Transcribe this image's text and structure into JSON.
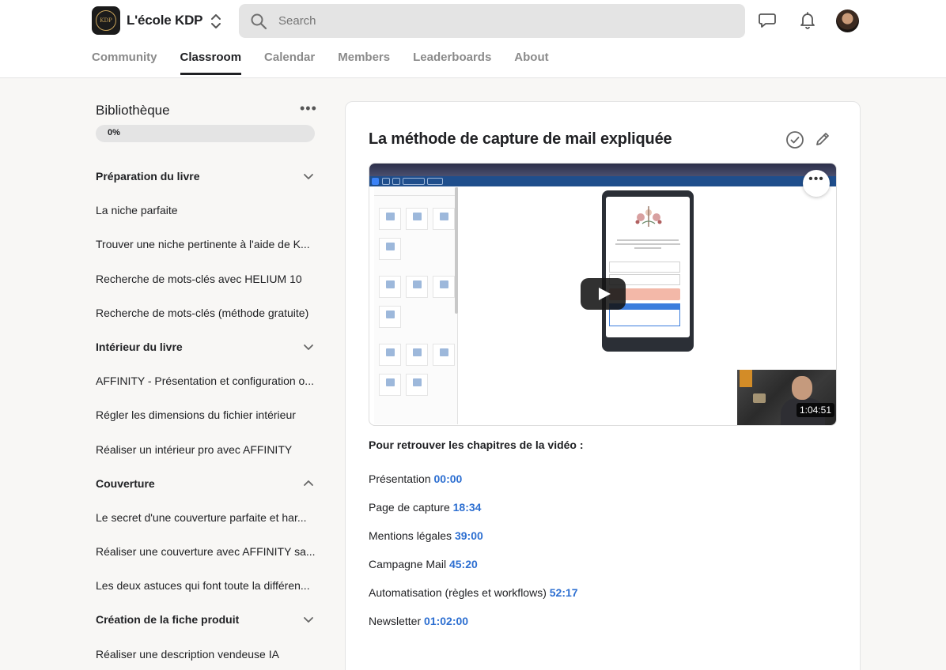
{
  "header": {
    "brand": "L'école KDP",
    "logo_text": "KDP",
    "search": {
      "placeholder": "Search",
      "value": ""
    },
    "icons": [
      "chat-icon",
      "bell-icon",
      "avatar"
    ]
  },
  "tabs": [
    {
      "label": "Community",
      "active": false
    },
    {
      "label": "Classroom",
      "active": true
    },
    {
      "label": "Calendar",
      "active": false
    },
    {
      "label": "Members",
      "active": false
    },
    {
      "label": "Leaderboards",
      "active": false
    },
    {
      "label": "About",
      "active": false
    }
  ],
  "sidebar": {
    "title": "Bibliothèque",
    "progress_label": "0%",
    "progress": 0,
    "nav": [
      {
        "type": "section",
        "label": "Préparation du livre",
        "expanded": false
      },
      {
        "type": "lesson",
        "label": "La niche parfaite"
      },
      {
        "type": "lesson",
        "label": "Trouver une niche pertinente à l'aide de K..."
      },
      {
        "type": "lesson",
        "label": "Recherche de mots-clés avec HELIUM 10"
      },
      {
        "type": "lesson",
        "label": "Recherche de mots-clés (méthode gratuite)"
      },
      {
        "type": "section",
        "label": "Intérieur du livre",
        "expanded": false
      },
      {
        "type": "lesson",
        "label": "AFFINITY - Présentation et configuration o..."
      },
      {
        "type": "lesson",
        "label": "Régler les dimensions du fichier intérieur"
      },
      {
        "type": "lesson",
        "label": "Réaliser un intérieur pro avec AFFINITY"
      },
      {
        "type": "section",
        "label": "Couverture",
        "expanded": true
      },
      {
        "type": "lesson",
        "label": "Le secret d'une couverture parfaite et har..."
      },
      {
        "type": "lesson",
        "label": "Réaliser une couverture avec AFFINITY sa..."
      },
      {
        "type": "lesson",
        "label": "Les deux astuces qui font toute la différen..."
      },
      {
        "type": "section",
        "label": "Création de la fiche produit",
        "expanded": false
      },
      {
        "type": "lesson",
        "label": "Réaliser une description vendeuse IA"
      }
    ]
  },
  "lesson": {
    "title": "La méthode de capture de mail expliquée",
    "video": {
      "duration": "1:04:51",
      "more_label": "•••"
    },
    "chapters_heading": "Pour retrouver les chapitres de la vidéo :",
    "chapters": [
      {
        "label": "Présentation",
        "time": "00:00"
      },
      {
        "label": "Page de capture",
        "time": "18:34"
      },
      {
        "label": "Mentions légales",
        "time": "39:00"
      },
      {
        "label": "Campagne Mail",
        "time": "45:20"
      },
      {
        "label": "Automatisation (règles et workflows)",
        "time": "52:17"
      },
      {
        "label": "Newsletter",
        "time": "01:02:00"
      }
    ]
  },
  "colors": {
    "accent_link": "#2d6fd1",
    "text": "#202124",
    "muted": "#8a8a8a",
    "page_bg": "#f8f7f5"
  }
}
